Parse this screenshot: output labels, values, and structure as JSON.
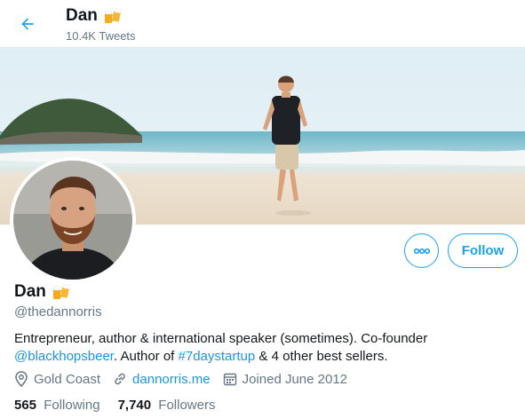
{
  "header": {
    "name": "Dan",
    "tweet_count": "10.4K Tweets"
  },
  "profile": {
    "name": "Dan",
    "handle": "@thedannorris",
    "bio_part1": "Entrepreneur, author & international speaker (sometimes). Co-founder",
    "bio_mention": "@blackhopsbeer",
    "bio_part2": ". Author of ",
    "bio_hashtag": "#7daystartup",
    "bio_part3": " & 4 other best sellers.",
    "location": "Gold Coast",
    "website": "dannorris.me",
    "joined": "Joined June 2012",
    "following_count": "565",
    "following_label": "Following",
    "followers_count": "7,740",
    "followers_label": "Followers"
  },
  "actions": {
    "follow_label": "Follow"
  },
  "icons": {
    "back": "arrow-left-icon",
    "beer": "beer-mugs-emoji",
    "more": "more-dots-icon",
    "location": "location-pin-icon",
    "link": "link-icon",
    "calendar": "calendar-icon"
  },
  "colors": {
    "accent": "#1da1f2",
    "link": "#1b95e0",
    "secondary_text": "#657786",
    "primary_text": "#14171a"
  }
}
